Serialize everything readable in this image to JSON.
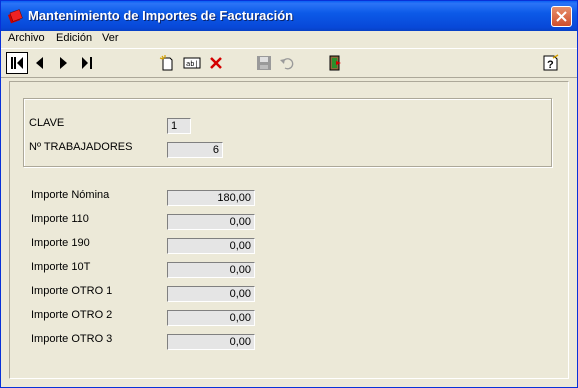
{
  "window": {
    "title": "Mantenimiento de Importes de Facturación"
  },
  "menu": [
    "Archivo",
    "Edición",
    "Ver"
  ],
  "toolbar": {
    "icons": [
      "first-record-icon",
      "previous-record-icon",
      "next-record-icon",
      "last-record-icon",
      "new-record-icon",
      "edit-record-icon",
      "delete-record-icon",
      "save-icon",
      "undo-icon",
      "exit-icon",
      "help-icon"
    ]
  },
  "form": {
    "clave_label": "CLAVE",
    "clave_value": "1",
    "trabajadores_label": "Nº TRABAJADORES",
    "trabajadores_value": "6",
    "importes": [
      {
        "label": "Importe Nómina",
        "value": "180,00"
      },
      {
        "label": "Importe 110",
        "value": "0,00"
      },
      {
        "label": "Importe 190",
        "value": "0,00"
      },
      {
        "label": "Importe 10T",
        "value": "0,00"
      },
      {
        "label": "Importe OTRO 1",
        "value": "0,00"
      },
      {
        "label": "Importe OTRO 2",
        "value": "0,00"
      },
      {
        "label": "Importe OTRO 3",
        "value": "0,00"
      }
    ]
  },
  "colors": {
    "titlebar": "#0a5ff3",
    "window_bg": "#ece9d8",
    "field_bg": "#e5e5e5",
    "close": "#cf4e2a"
  }
}
